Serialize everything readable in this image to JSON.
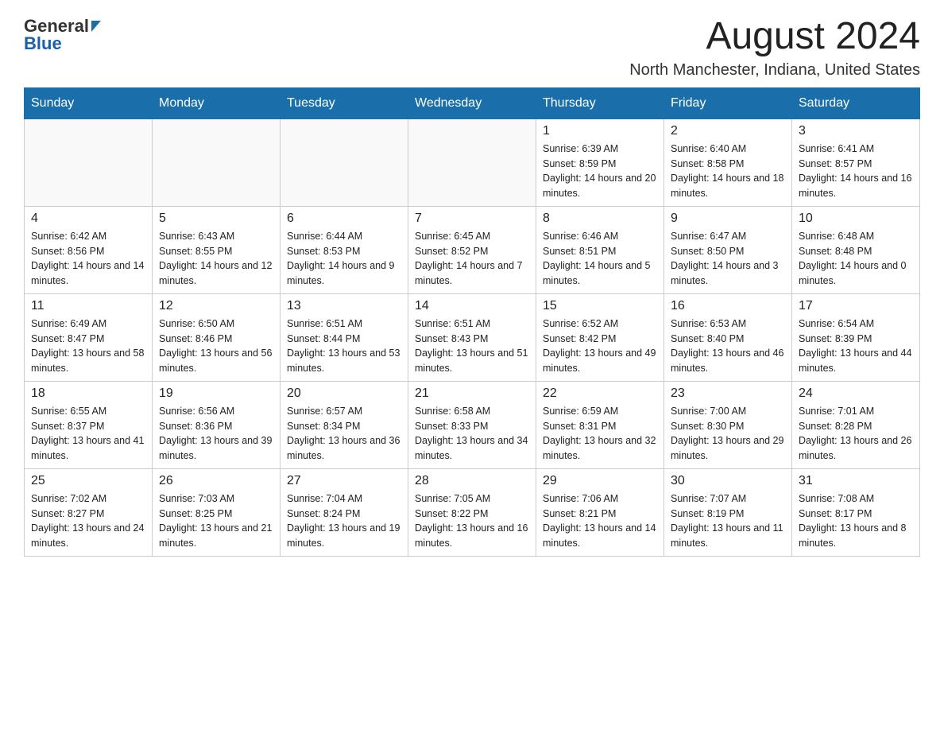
{
  "logo": {
    "general": "General",
    "blue": "Blue"
  },
  "header": {
    "month": "August 2024",
    "location": "North Manchester, Indiana, United States"
  },
  "weekdays": [
    "Sunday",
    "Monday",
    "Tuesday",
    "Wednesday",
    "Thursday",
    "Friday",
    "Saturday"
  ],
  "weeks": [
    [
      {
        "day": "",
        "info": ""
      },
      {
        "day": "",
        "info": ""
      },
      {
        "day": "",
        "info": ""
      },
      {
        "day": "",
        "info": ""
      },
      {
        "day": "1",
        "info": "Sunrise: 6:39 AM\nSunset: 8:59 PM\nDaylight: 14 hours and 20 minutes."
      },
      {
        "day": "2",
        "info": "Sunrise: 6:40 AM\nSunset: 8:58 PM\nDaylight: 14 hours and 18 minutes."
      },
      {
        "day": "3",
        "info": "Sunrise: 6:41 AM\nSunset: 8:57 PM\nDaylight: 14 hours and 16 minutes."
      }
    ],
    [
      {
        "day": "4",
        "info": "Sunrise: 6:42 AM\nSunset: 8:56 PM\nDaylight: 14 hours and 14 minutes."
      },
      {
        "day": "5",
        "info": "Sunrise: 6:43 AM\nSunset: 8:55 PM\nDaylight: 14 hours and 12 minutes."
      },
      {
        "day": "6",
        "info": "Sunrise: 6:44 AM\nSunset: 8:53 PM\nDaylight: 14 hours and 9 minutes."
      },
      {
        "day": "7",
        "info": "Sunrise: 6:45 AM\nSunset: 8:52 PM\nDaylight: 14 hours and 7 minutes."
      },
      {
        "day": "8",
        "info": "Sunrise: 6:46 AM\nSunset: 8:51 PM\nDaylight: 14 hours and 5 minutes."
      },
      {
        "day": "9",
        "info": "Sunrise: 6:47 AM\nSunset: 8:50 PM\nDaylight: 14 hours and 3 minutes."
      },
      {
        "day": "10",
        "info": "Sunrise: 6:48 AM\nSunset: 8:48 PM\nDaylight: 14 hours and 0 minutes."
      }
    ],
    [
      {
        "day": "11",
        "info": "Sunrise: 6:49 AM\nSunset: 8:47 PM\nDaylight: 13 hours and 58 minutes."
      },
      {
        "day": "12",
        "info": "Sunrise: 6:50 AM\nSunset: 8:46 PM\nDaylight: 13 hours and 56 minutes."
      },
      {
        "day": "13",
        "info": "Sunrise: 6:51 AM\nSunset: 8:44 PM\nDaylight: 13 hours and 53 minutes."
      },
      {
        "day": "14",
        "info": "Sunrise: 6:51 AM\nSunset: 8:43 PM\nDaylight: 13 hours and 51 minutes."
      },
      {
        "day": "15",
        "info": "Sunrise: 6:52 AM\nSunset: 8:42 PM\nDaylight: 13 hours and 49 minutes."
      },
      {
        "day": "16",
        "info": "Sunrise: 6:53 AM\nSunset: 8:40 PM\nDaylight: 13 hours and 46 minutes."
      },
      {
        "day": "17",
        "info": "Sunrise: 6:54 AM\nSunset: 8:39 PM\nDaylight: 13 hours and 44 minutes."
      }
    ],
    [
      {
        "day": "18",
        "info": "Sunrise: 6:55 AM\nSunset: 8:37 PM\nDaylight: 13 hours and 41 minutes."
      },
      {
        "day": "19",
        "info": "Sunrise: 6:56 AM\nSunset: 8:36 PM\nDaylight: 13 hours and 39 minutes."
      },
      {
        "day": "20",
        "info": "Sunrise: 6:57 AM\nSunset: 8:34 PM\nDaylight: 13 hours and 36 minutes."
      },
      {
        "day": "21",
        "info": "Sunrise: 6:58 AM\nSunset: 8:33 PM\nDaylight: 13 hours and 34 minutes."
      },
      {
        "day": "22",
        "info": "Sunrise: 6:59 AM\nSunset: 8:31 PM\nDaylight: 13 hours and 32 minutes."
      },
      {
        "day": "23",
        "info": "Sunrise: 7:00 AM\nSunset: 8:30 PM\nDaylight: 13 hours and 29 minutes."
      },
      {
        "day": "24",
        "info": "Sunrise: 7:01 AM\nSunset: 8:28 PM\nDaylight: 13 hours and 26 minutes."
      }
    ],
    [
      {
        "day": "25",
        "info": "Sunrise: 7:02 AM\nSunset: 8:27 PM\nDaylight: 13 hours and 24 minutes."
      },
      {
        "day": "26",
        "info": "Sunrise: 7:03 AM\nSunset: 8:25 PM\nDaylight: 13 hours and 21 minutes."
      },
      {
        "day": "27",
        "info": "Sunrise: 7:04 AM\nSunset: 8:24 PM\nDaylight: 13 hours and 19 minutes."
      },
      {
        "day": "28",
        "info": "Sunrise: 7:05 AM\nSunset: 8:22 PM\nDaylight: 13 hours and 16 minutes."
      },
      {
        "day": "29",
        "info": "Sunrise: 7:06 AM\nSunset: 8:21 PM\nDaylight: 13 hours and 14 minutes."
      },
      {
        "day": "30",
        "info": "Sunrise: 7:07 AM\nSunset: 8:19 PM\nDaylight: 13 hours and 11 minutes."
      },
      {
        "day": "31",
        "info": "Sunrise: 7:08 AM\nSunset: 8:17 PM\nDaylight: 13 hours and 8 minutes."
      }
    ]
  ]
}
